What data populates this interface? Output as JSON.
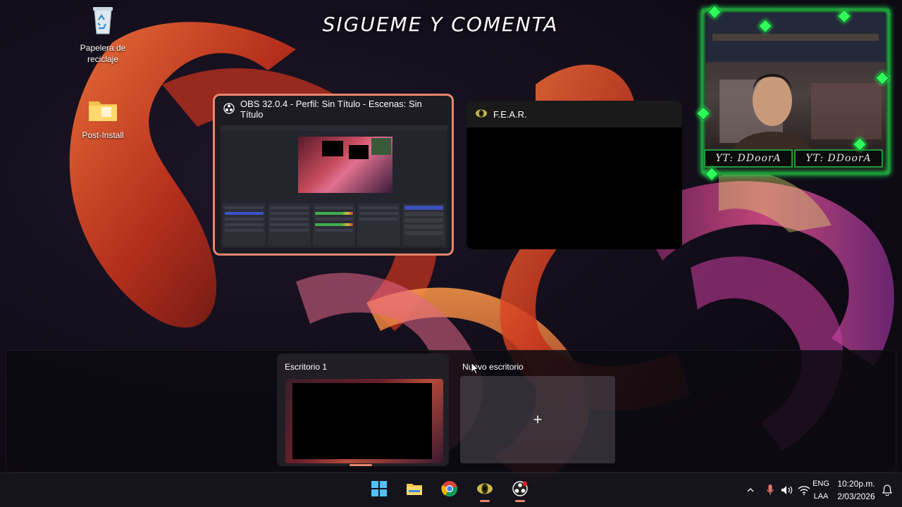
{
  "overlay": {
    "title": "SIGUEME Y COMENTA"
  },
  "desktop_icons": [
    {
      "label": "Papelera de reciclaje",
      "icon": "recycle-bin-icon"
    },
    {
      "label": "Post-Install",
      "icon": "folder-icon"
    }
  ],
  "task_view": {
    "windows": [
      {
        "title": "OBS 32.0.4 - Perfil: Sin Título - Escenas: Sin Título",
        "icon": "obs-icon",
        "selected": true
      },
      {
        "title": "F.E.A.R.",
        "icon": "fear-icon",
        "selected": false
      }
    ]
  },
  "webcam": {
    "left_label": "YT: DDoorA",
    "right_label": "YT: DDoorA",
    "frame_color": "#1e9a3a"
  },
  "desktops": {
    "items": [
      {
        "label": "Escritorio 1"
      }
    ],
    "new_desktop": {
      "label": "Nuevo escritorio",
      "plus": "+"
    }
  },
  "taskbar": {
    "apps": [
      {
        "name": "start",
        "icon": "windows-start-icon"
      },
      {
        "name": "file-explorer",
        "icon": "folder-icon"
      },
      {
        "name": "chrome",
        "icon": "chrome-icon"
      },
      {
        "name": "fear",
        "icon": "fear-icon",
        "running": true
      },
      {
        "name": "obs",
        "icon": "obs-icon",
        "running": true
      }
    ],
    "tray": {
      "language_top": "ENG",
      "language_bottom": "LAA",
      "time": "10:20p.m.",
      "date": "2/03/2026"
    }
  },
  "colors": {
    "accent": "#e8866d",
    "cam_glow": "#2fff5a"
  }
}
